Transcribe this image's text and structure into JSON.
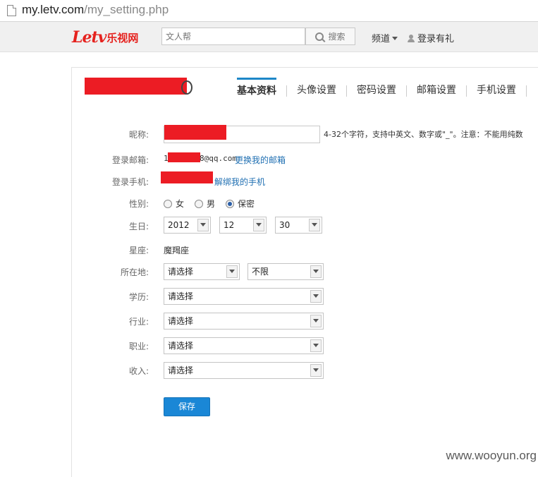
{
  "browser": {
    "url_host": "my.letv.com",
    "url_path": "/my_setting.php"
  },
  "header": {
    "logo_latin": "Letv",
    "logo_cn": "乐视网",
    "search_placeholder": "文人帮",
    "search_button": "搜索",
    "channel_menu": "频道",
    "login_link": "登录有礼",
    "brand_color": "#e5221e"
  },
  "tabs": [
    {
      "label": "基本资料",
      "active": true
    },
    {
      "label": "头像设置",
      "active": false
    },
    {
      "label": "密码设置",
      "active": false
    },
    {
      "label": "邮箱设置",
      "active": false
    },
    {
      "label": "手机设置",
      "active": false
    }
  ],
  "form": {
    "nickname_label": "昵称:",
    "nickname_hint": "4-32个字符，支持中英文、数字或\"_\"。注意：不能用纯数",
    "email_label": "登录邮箱:",
    "email_prefix": "1",
    "email_suffix": "8@qq.com",
    "email_change_link": "更换我的邮箱",
    "phone_label": "登录手机:",
    "phone_unbind_link": "解绑我的手机",
    "gender_label": "性别:",
    "gender_options": [
      "女",
      "男",
      "保密"
    ],
    "gender_selected": "保密",
    "birthday_label": "生日:",
    "birth_year": "2012",
    "birth_month": "12",
    "birth_day": "30",
    "zodiac_label": "星座:",
    "zodiac_value": "魔羯座",
    "location_label": "所在地:",
    "location_province": "请选择",
    "location_city": "不限",
    "education_label": "学历:",
    "education_value": "请选择",
    "industry_label": "行业:",
    "industry_value": "请选择",
    "job_label": "职业:",
    "job_value": "请选择",
    "income_label": "收入:",
    "income_value": "请选择",
    "save_button": "保存"
  },
  "watermark": "www.wooyun.org"
}
